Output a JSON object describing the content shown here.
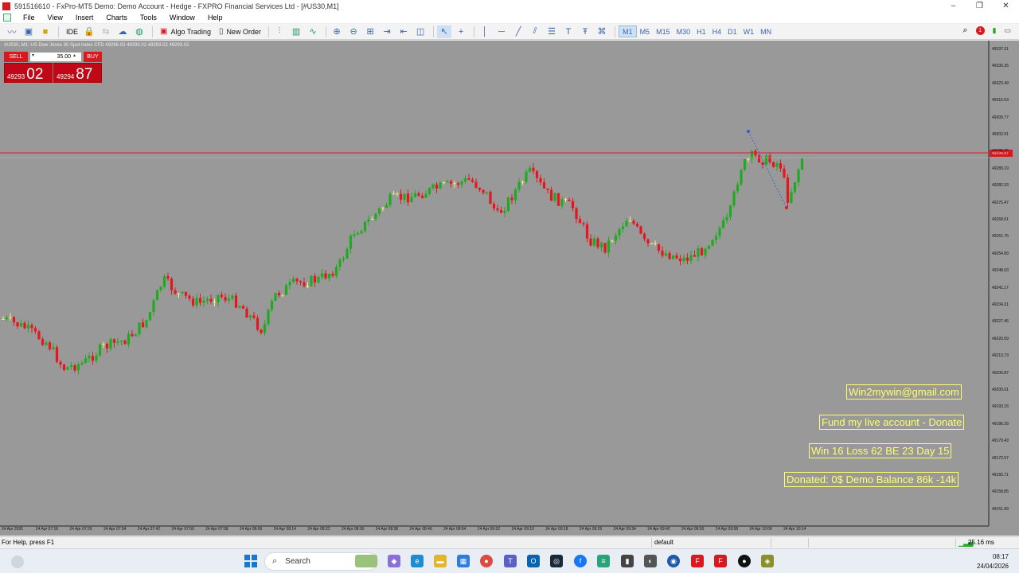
{
  "window": {
    "title": "591516610 - FxPro-MT5 Demo: Demo Account - Hedge - FXPRO Financial Services Ltd - [#US30,M1]",
    "controls": [
      "–",
      "❐",
      "✕"
    ]
  },
  "menu": [
    "File",
    "View",
    "Insert",
    "Charts",
    "Tools",
    "Window",
    "Help"
  ],
  "toolbar": {
    "ide_label": "IDE",
    "algo_trading": "Algo Trading",
    "new_order": "New Order",
    "timeframes": [
      "M1",
      "M5",
      "M15",
      "M30",
      "H1",
      "H4",
      "D1",
      "W1",
      "MN"
    ],
    "active_timeframe": "M1",
    "notification_count": "1"
  },
  "chart": {
    "header": "#US30, M1: US Dow Jones 30 Spot Index CFD  49296.02 49293.02 49293.02 49293.02",
    "one_click": {
      "sell_label": "SELL",
      "buy_label": "BUY",
      "volume": "35.00",
      "sell_price_small": "49293",
      "sell_price_big": "02",
      "buy_price_small": "49294",
      "buy_price_big": "87"
    },
    "current_price_tag": "49294.87",
    "price_axis": [
      "49337.21",
      "49330.35",
      "49323.49",
      "49316.63",
      "49309.77",
      "49302.91",
      "49296.05",
      "49289.19",
      "49282.33",
      "49275.47",
      "49268.61",
      "49261.75",
      "49254.89",
      "49248.03",
      "49241.17",
      "49234.31",
      "49227.45",
      "49220.59",
      "49213.73",
      "49206.87",
      "49200.01",
      "49193.15",
      "49186.29",
      "49179.43",
      "49172.57",
      "49165.71",
      "49158.85",
      "49151.99"
    ],
    "time_axis": [
      "24 Apr 2026",
      "24 Apr 07:18",
      "24 Apr 07:26",
      "24 Apr 07:34",
      "24 Apr 07:42",
      "24 Apr 07:50",
      "24 Apr 07:58",
      "24 Apr 08:06",
      "24 Apr 08:14",
      "24 Apr 08:22",
      "24 Apr 08:30",
      "24 Apr 08:38",
      "24 Apr 08:46",
      "24 Apr 08:54",
      "24 Apr 09:02",
      "24 Apr 09:10",
      "24 Apr 09:18",
      "24 Apr 09:26",
      "24 Apr 09:34",
      "24 Apr 09:42",
      "24 Apr 09:50",
      "24 Apr 09:58",
      "24 Apr 10:06",
      "24 Apr 10:14"
    ],
    "overlay_labels": [
      "Win2mywin@gmail.com",
      "Fund my live account - Donate",
      "Win 16  Loss 62  BE 23  Day 15",
      "Donated: 0$  Demo Balance 86k -14k"
    ],
    "colors": {
      "background": "#999999",
      "bull": "#1faa1f",
      "bear": "#e5161f",
      "doji": "#f2f27a",
      "price_line": "#d71920",
      "label": "#ffff70"
    }
  },
  "status": {
    "help": "For Help, press F1",
    "profile": "default",
    "ping": "25.16 ms"
  },
  "taskbar": {
    "search": "Search",
    "time": "08:17",
    "date": "24/04/2026"
  }
}
